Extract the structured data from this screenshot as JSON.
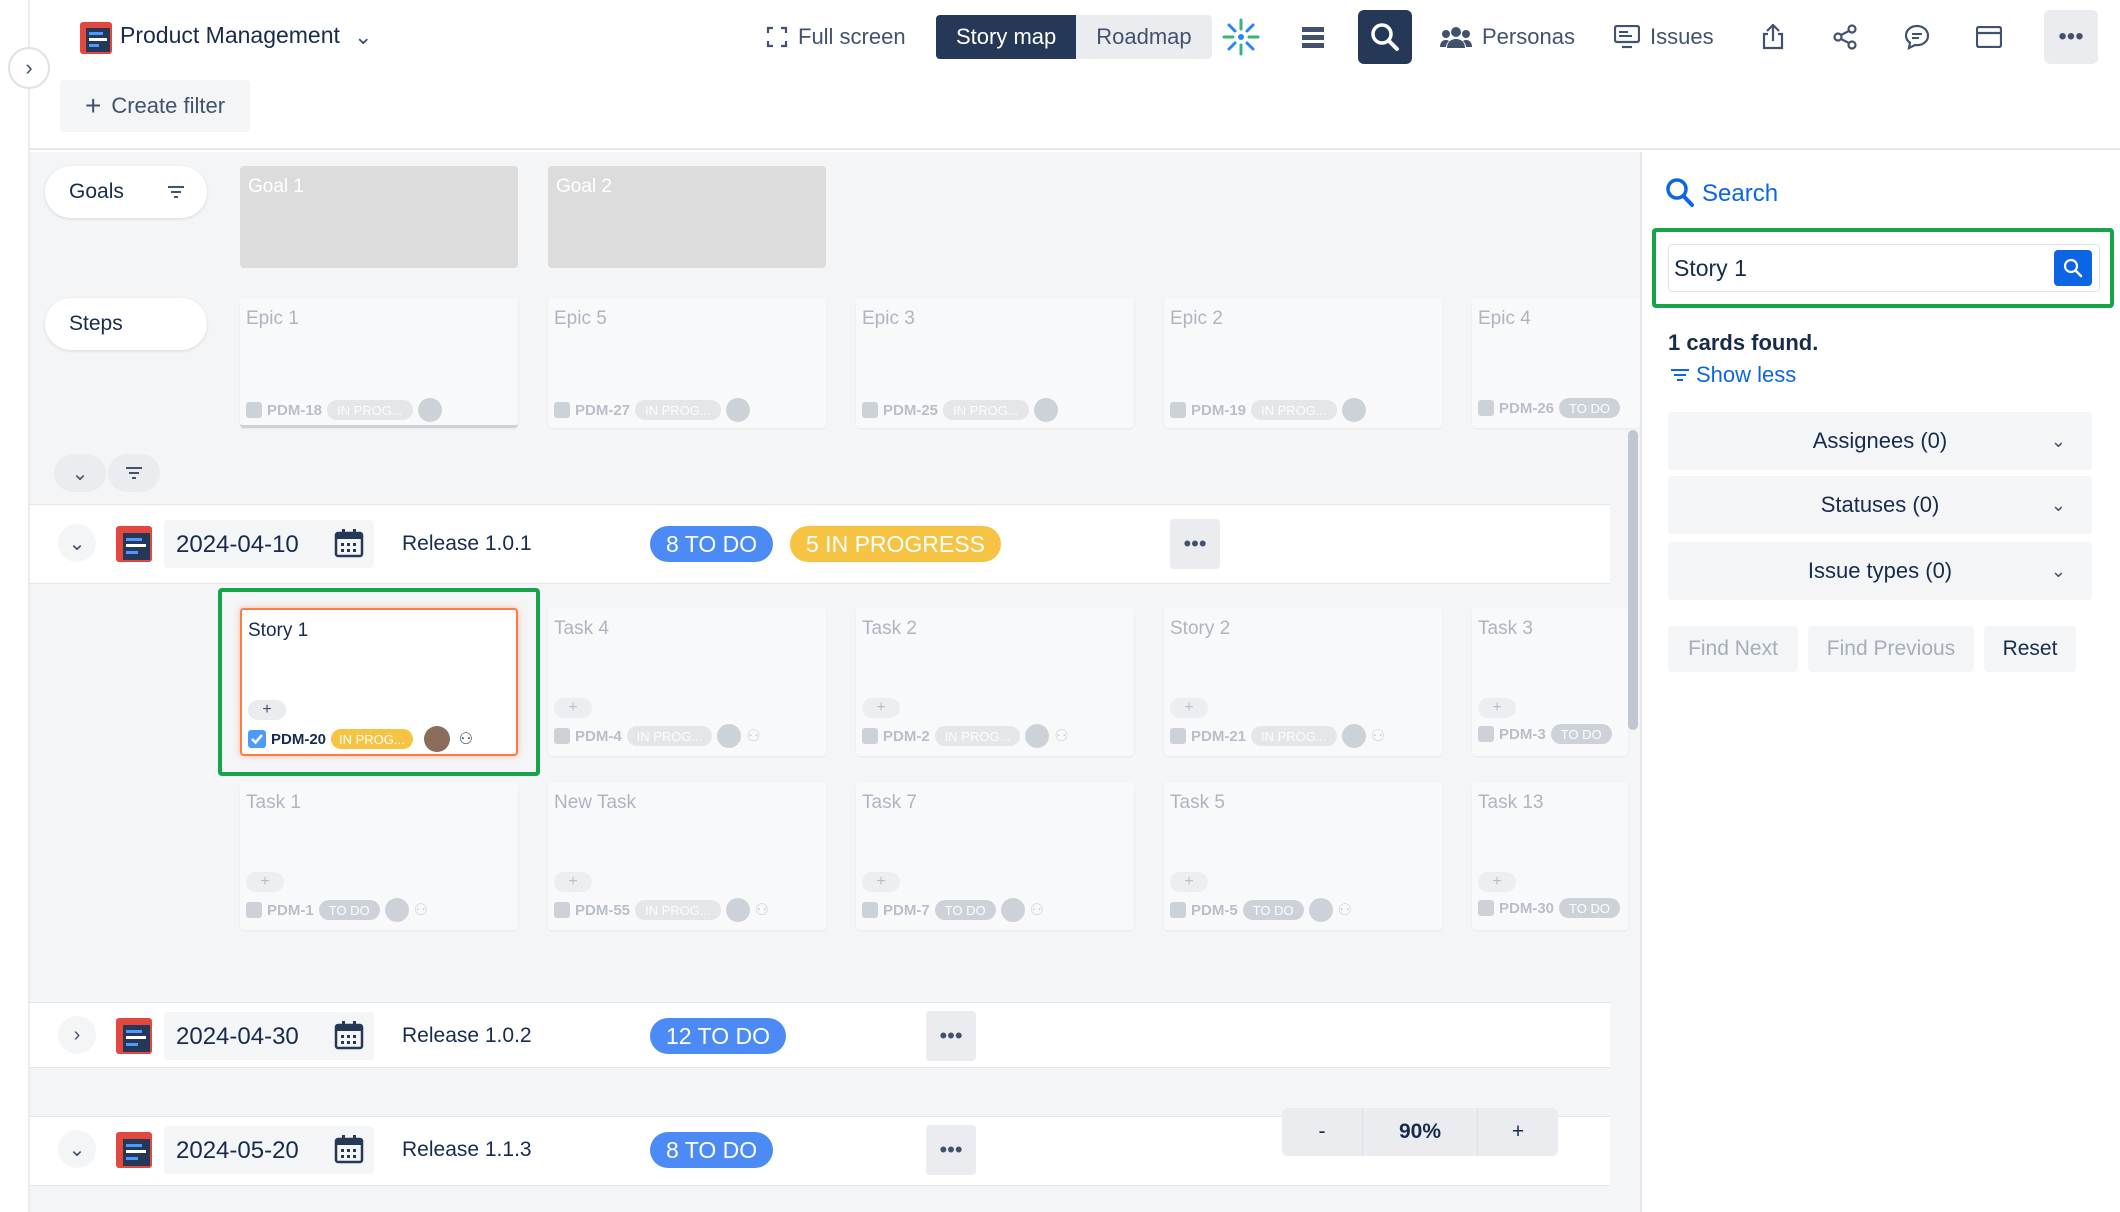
{
  "header": {
    "project_name": "Product Management",
    "full_screen": "Full screen",
    "views": [
      "Story map",
      "Roadmap"
    ],
    "personas": "Personas",
    "issues": "Issues",
    "create_filter": "Create filter"
  },
  "rows": {
    "goals": "Goals",
    "steps": "Steps"
  },
  "goals": [
    "Goal 1",
    "Goal 2"
  ],
  "epics": [
    {
      "title": "Epic 1",
      "key": "PDM-18",
      "status": "IN PROG..."
    },
    {
      "title": "Epic 5",
      "key": "PDM-27",
      "status": "IN PROG..."
    },
    {
      "title": "Epic 3",
      "key": "PDM-25",
      "status": "IN PROG..."
    },
    {
      "title": "Epic 2",
      "key": "PDM-19",
      "status": "IN PROG..."
    },
    {
      "title": "Epic 4",
      "key": "PDM-26",
      "status": "TO DO"
    }
  ],
  "releases": [
    {
      "date": "2024-04-10",
      "name": "Release 1.0.1",
      "todo": "8 TO DO",
      "inprogress": "5 IN PROGRESS"
    },
    {
      "date": "2024-04-30",
      "name": "Release 1.0.2",
      "todo": "12 TO DO"
    },
    {
      "date": "2024-05-20",
      "name": "Release 1.1.3",
      "todo": "8 TO DO"
    }
  ],
  "cards_row1": [
    {
      "title": "Story 1",
      "key": "PDM-20",
      "status": "IN PROG..."
    },
    {
      "title": "Task 4",
      "key": "PDM-4",
      "status": "IN PROG..."
    },
    {
      "title": "Task 2",
      "key": "PDM-2",
      "status": "IN PROG..."
    },
    {
      "title": "Story 2",
      "key": "PDM-21",
      "status": "IN PROG..."
    },
    {
      "title": "Task 3",
      "key": "PDM-3",
      "status": "TO DO"
    }
  ],
  "cards_row2": [
    {
      "title": "Task 1",
      "key": "PDM-1",
      "status": "TO DO"
    },
    {
      "title": "New Task",
      "key": "PDM-55",
      "status": "IN PROG..."
    },
    {
      "title": "Task 7",
      "key": "PDM-7",
      "status": "TO DO"
    },
    {
      "title": "Task 5",
      "key": "PDM-5",
      "status": "TO DO"
    },
    {
      "title": "Task 13",
      "key": "PDM-30",
      "status": "TO DO"
    }
  ],
  "card_plus": "+",
  "panel": {
    "title": "Search",
    "query": "Story 1",
    "found": "1 cards found.",
    "show_less": "Show less",
    "filters": [
      "Assignees (0)",
      "Statuses (0)",
      "Issue types (0)"
    ],
    "find_next": "Find Next",
    "find_previous": "Find Previous",
    "reset": "Reset"
  },
  "zoom": {
    "minus": "-",
    "level": "90%",
    "plus": "+"
  },
  "colors": {
    "todo": "#4c8bf5",
    "inprogress": "#f6c342",
    "highlight": "#16a34a",
    "selected_card": "#ff7a45",
    "search_button": "#0c66e4"
  }
}
